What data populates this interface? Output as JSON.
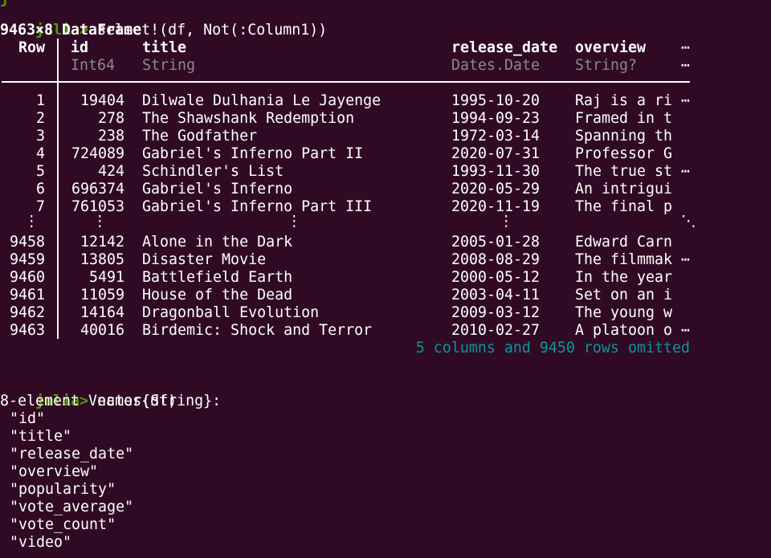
{
  "terminal": {
    "prompt": "julia>",
    "commands": [
      {
        "input": "select!(df, Not(:Column1))",
        "output_header": "9463×8 DataFrame",
        "table": {
          "row_label": "Row",
          "columns": [
            {
              "name": "id",
              "type": "Int64"
            },
            {
              "name": "title",
              "type": "String"
            },
            {
              "name": "release_date",
              "type": "Dates.Date"
            },
            {
              "name": "overview",
              "type": "String?"
            }
          ],
          "truncation_marker": "⋯",
          "rows": [
            {
              "row": "1",
              "id": "19404",
              "title": "Dilwale Dulhania Le Jayenge",
              "release_date": "1995-10-20",
              "overview": "Raj is a ri",
              "more": "⋯"
            },
            {
              "row": "2",
              "id": "278",
              "title": "The Shawshank Redemption",
              "release_date": "1994-09-23",
              "overview": "Framed in t",
              "more": ""
            },
            {
              "row": "3",
              "id": "238",
              "title": "The Godfather",
              "release_date": "1972-03-14",
              "overview": "Spanning th",
              "more": ""
            },
            {
              "row": "4",
              "id": "724089",
              "title": "Gabriel's Inferno Part II",
              "release_date": "2020-07-31",
              "overview": "Professor G",
              "more": ""
            },
            {
              "row": "5",
              "id": "424",
              "title": "Schindler's List",
              "release_date": "1993-11-30",
              "overview": "The true st",
              "more": "⋯"
            },
            {
              "row": "6",
              "id": "696374",
              "title": "Gabriel's Inferno",
              "release_date": "2020-05-29",
              "overview": "An intrigui",
              "more": ""
            },
            {
              "row": "7",
              "id": "761053",
              "title": "Gabriel's Inferno Part III",
              "release_date": "2020-11-19",
              "overview": "The final p",
              "more": ""
            },
            {
              "row": "⋮",
              "id": "⋮",
              "title": "⋮",
              "release_date": "⋮",
              "overview": "",
              "more": "⋱"
            },
            {
              "row": "9458",
              "id": "12142",
              "title": "Alone in the Dark",
              "release_date": "2005-01-28",
              "overview": "Edward Carn",
              "more": ""
            },
            {
              "row": "9459",
              "id": "13805",
              "title": "Disaster Movie",
              "release_date": "2008-08-29",
              "overview": "The filmmak",
              "more": "⋯"
            },
            {
              "row": "9460",
              "id": "5491",
              "title": "Battlefield Earth",
              "release_date": "2000-05-12",
              "overview": "In the year",
              "more": ""
            },
            {
              "row": "9461",
              "id": "11059",
              "title": "House of the Dead",
              "release_date": "2003-04-11",
              "overview": "Set on an i",
              "more": ""
            },
            {
              "row": "9462",
              "id": "14164",
              "title": "Dragonball Evolution",
              "release_date": "2009-03-12",
              "overview": "The young w",
              "more": ""
            },
            {
              "row": "9463",
              "id": "40016",
              "title": "Birdemic: Shock and Terror",
              "release_date": "2010-02-27",
              "overview": "A platoon o",
              "more": "⋯"
            }
          ],
          "omitted_note": "5 columns and 9450 rows omitted"
        }
      },
      {
        "input": "names(df)",
        "output_header": "8-element Vector{String}:",
        "items": [
          "\"id\"",
          "\"title\"",
          "\"release_date\"",
          "\"overview\"",
          "\"popularity\"",
          "\"vote_average\"",
          "\"vote_count\"",
          "\"video\""
        ]
      }
    ],
    "colors": {
      "background": "#300a24",
      "prompt": "#4e9a06",
      "text": "#ffffff",
      "type_row": "#8a8a8a",
      "note": "#06989a"
    }
  }
}
